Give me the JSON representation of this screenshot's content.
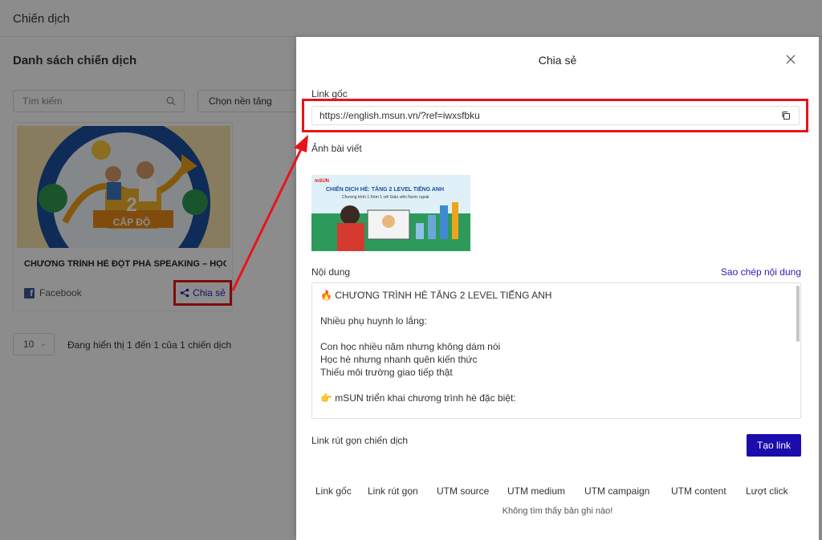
{
  "page": {
    "header_title": "Chiến dịch",
    "list_title": "Danh sách chiến dịch",
    "search_placeholder": "Tìm kiếm",
    "platform_select": "Chọn nền tảng",
    "card": {
      "title": "CHƯƠNG TRÌNH HÈ ĐỘT PHÁ SPEAKING – HỌC...",
      "platform": "Facebook",
      "share_label": "Chia sẻ",
      "image_text": "2",
      "image_caption": "CẤP ĐỘ"
    },
    "page_size": "10",
    "pagination_info": "Đang hiển thị 1 đến 1 của 1 chiến dịch"
  },
  "drawer": {
    "title": "Chia sẻ",
    "original_link_label": "Link gốc",
    "original_link_value": "https://english.msun.vn/?ref=iwxsfbku",
    "post_image_label": "Ảnh bài viết",
    "post_image": {
      "brand": "mSUN",
      "headline": "CHIẾN DỊCH HÈ: TĂNG 2 LEVEL TIẾNG ANH",
      "subline": "Chương trình 1 Kèm 1 với Giáo viên Nước ngoài"
    },
    "content_label": "Nội dung",
    "copy_content_label": "Sao chép nội dung",
    "content_lines": [
      "🔥 CHƯƠNG TRÌNH HÈ TĂNG 2 LEVEL TIẾNG ANH",
      "",
      "Nhiều phụ huynh lo lắng:",
      "",
      "Con học nhiều năm nhưng không dám nói",
      "Học hè nhưng nhanh quên kiến thức",
      "Thiếu môi trường giao tiếp thật",
      "",
      "👉 mSUN triển khai chương trình hè đặc biệt:"
    ],
    "short_link_label": "Link rút gọn chiến dịch",
    "create_link_button": "Tạo link",
    "table_columns": [
      "Link gốc",
      "Link rút gọn",
      "UTM source",
      "UTM medium",
      "UTM campaign",
      "UTM content",
      "Lượt click"
    ],
    "empty_text": "Không tìm thấy bản ghi nào!"
  },
  "colors": {
    "accent": "#1a0dab",
    "annotation": "#e8141b",
    "link_text": "#2b21b3"
  }
}
